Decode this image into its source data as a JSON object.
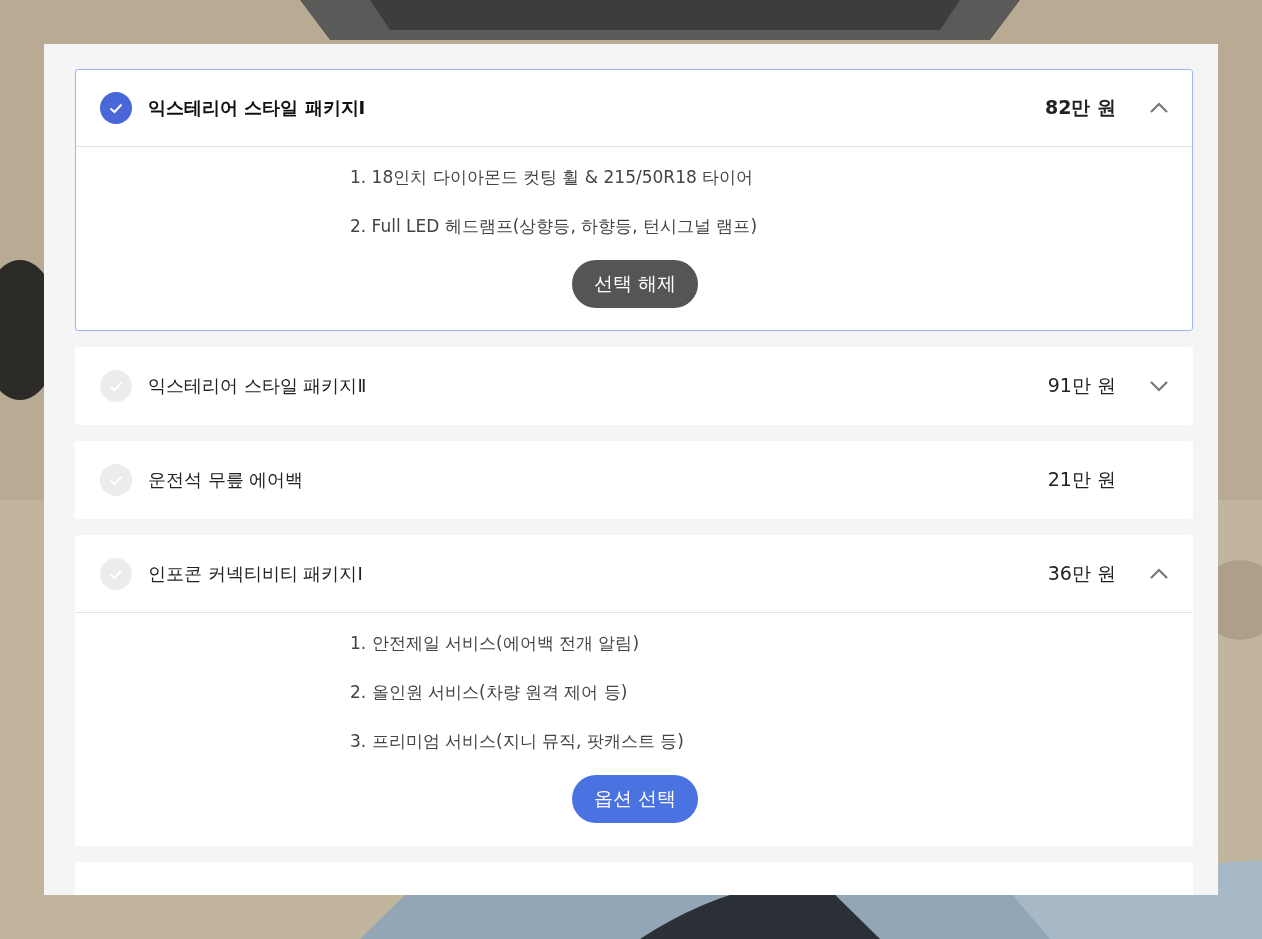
{
  "options": [
    {
      "kind": "expandable",
      "title": "익스테리어 스타일 패키지Ⅰ",
      "price": "82만 원",
      "selected": true,
      "expanded": true,
      "details": [
        "1. 18인치 다이아몬드 컷팅 휠 & 215/50R18 타이어",
        "2. Full LED 헤드램프(상향등, 하향등, 턴시그널 램프)"
      ],
      "button": {
        "kind": "deselect",
        "label": "선택 해제"
      }
    },
    {
      "kind": "expandable",
      "title": "익스테리어 스타일 패키지Ⅱ",
      "price": "91만 원",
      "selected": false,
      "expanded": false
    },
    {
      "kind": "plain",
      "title": "운전석 무릎 에어백",
      "price": "21만 원",
      "selected": false
    },
    {
      "kind": "expandable",
      "title": "인포콘 커넥티비티 패키지Ⅰ",
      "price": "36만 원",
      "selected": false,
      "expanded": true,
      "details": [
        "1. 안전제일 서비스(에어백 전개 알림)",
        "2. 올인원 서비스(차량 원격 제어 등)",
        "3. 프리미엄 서비스(지니 뮤직, 팟캐스트 등)"
      ],
      "button": {
        "kind": "select",
        "label": "옵션 선택"
      }
    }
  ]
}
